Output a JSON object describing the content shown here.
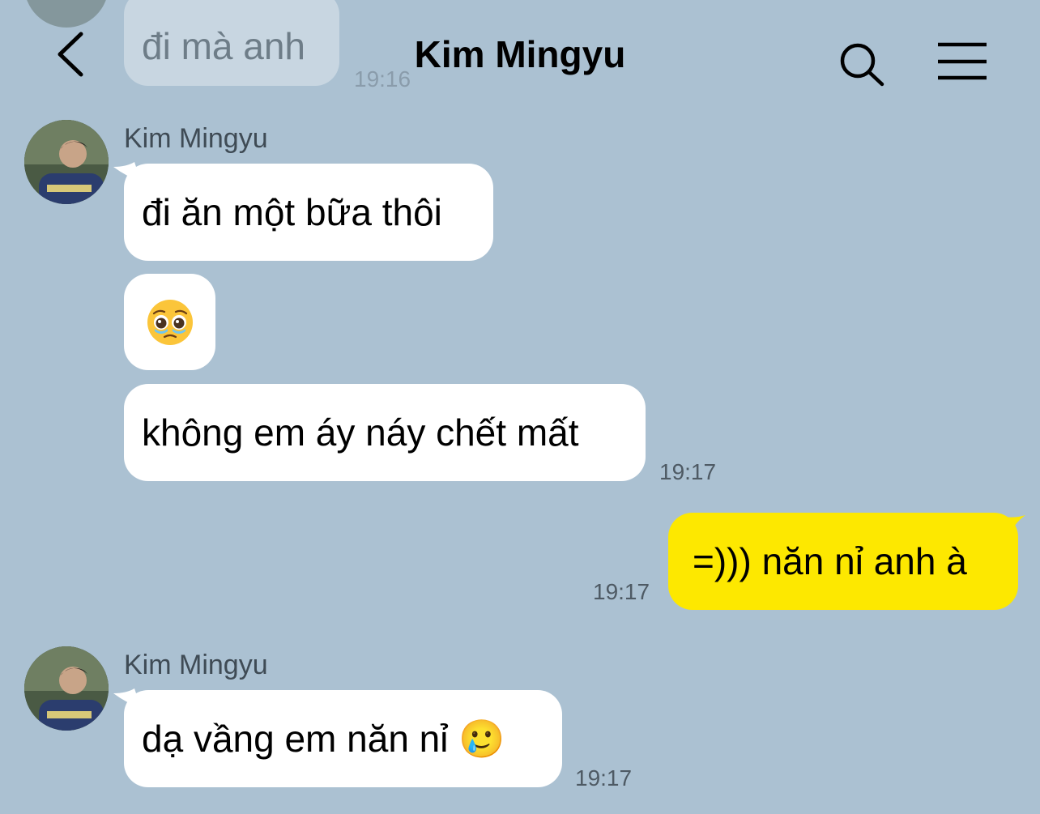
{
  "header": {
    "title": "Kim Mingyu",
    "back_icon": "chevron-left-icon",
    "search_icon": "search-icon",
    "menu_icon": "hamburger-menu-icon"
  },
  "previous_message": {
    "text": "đi mà anh",
    "time": "19:16"
  },
  "group1": {
    "sender": "Kim Mingyu",
    "messages": [
      "đi ăn một bữa thôi",
      "🥹",
      "không em áy náy chết mất"
    ],
    "time": "19:17"
  },
  "outgoing": {
    "text": "=))) năn nỉ anh à",
    "time": "19:17"
  },
  "group2": {
    "sender": "Kim Mingyu",
    "messages": [
      "dạ vầng em năn nỉ 🥲"
    ],
    "time": "19:17"
  },
  "colors": {
    "background": "#abc1d2",
    "incoming_bubble": "#ffffff",
    "outgoing_bubble": "#fde800"
  }
}
